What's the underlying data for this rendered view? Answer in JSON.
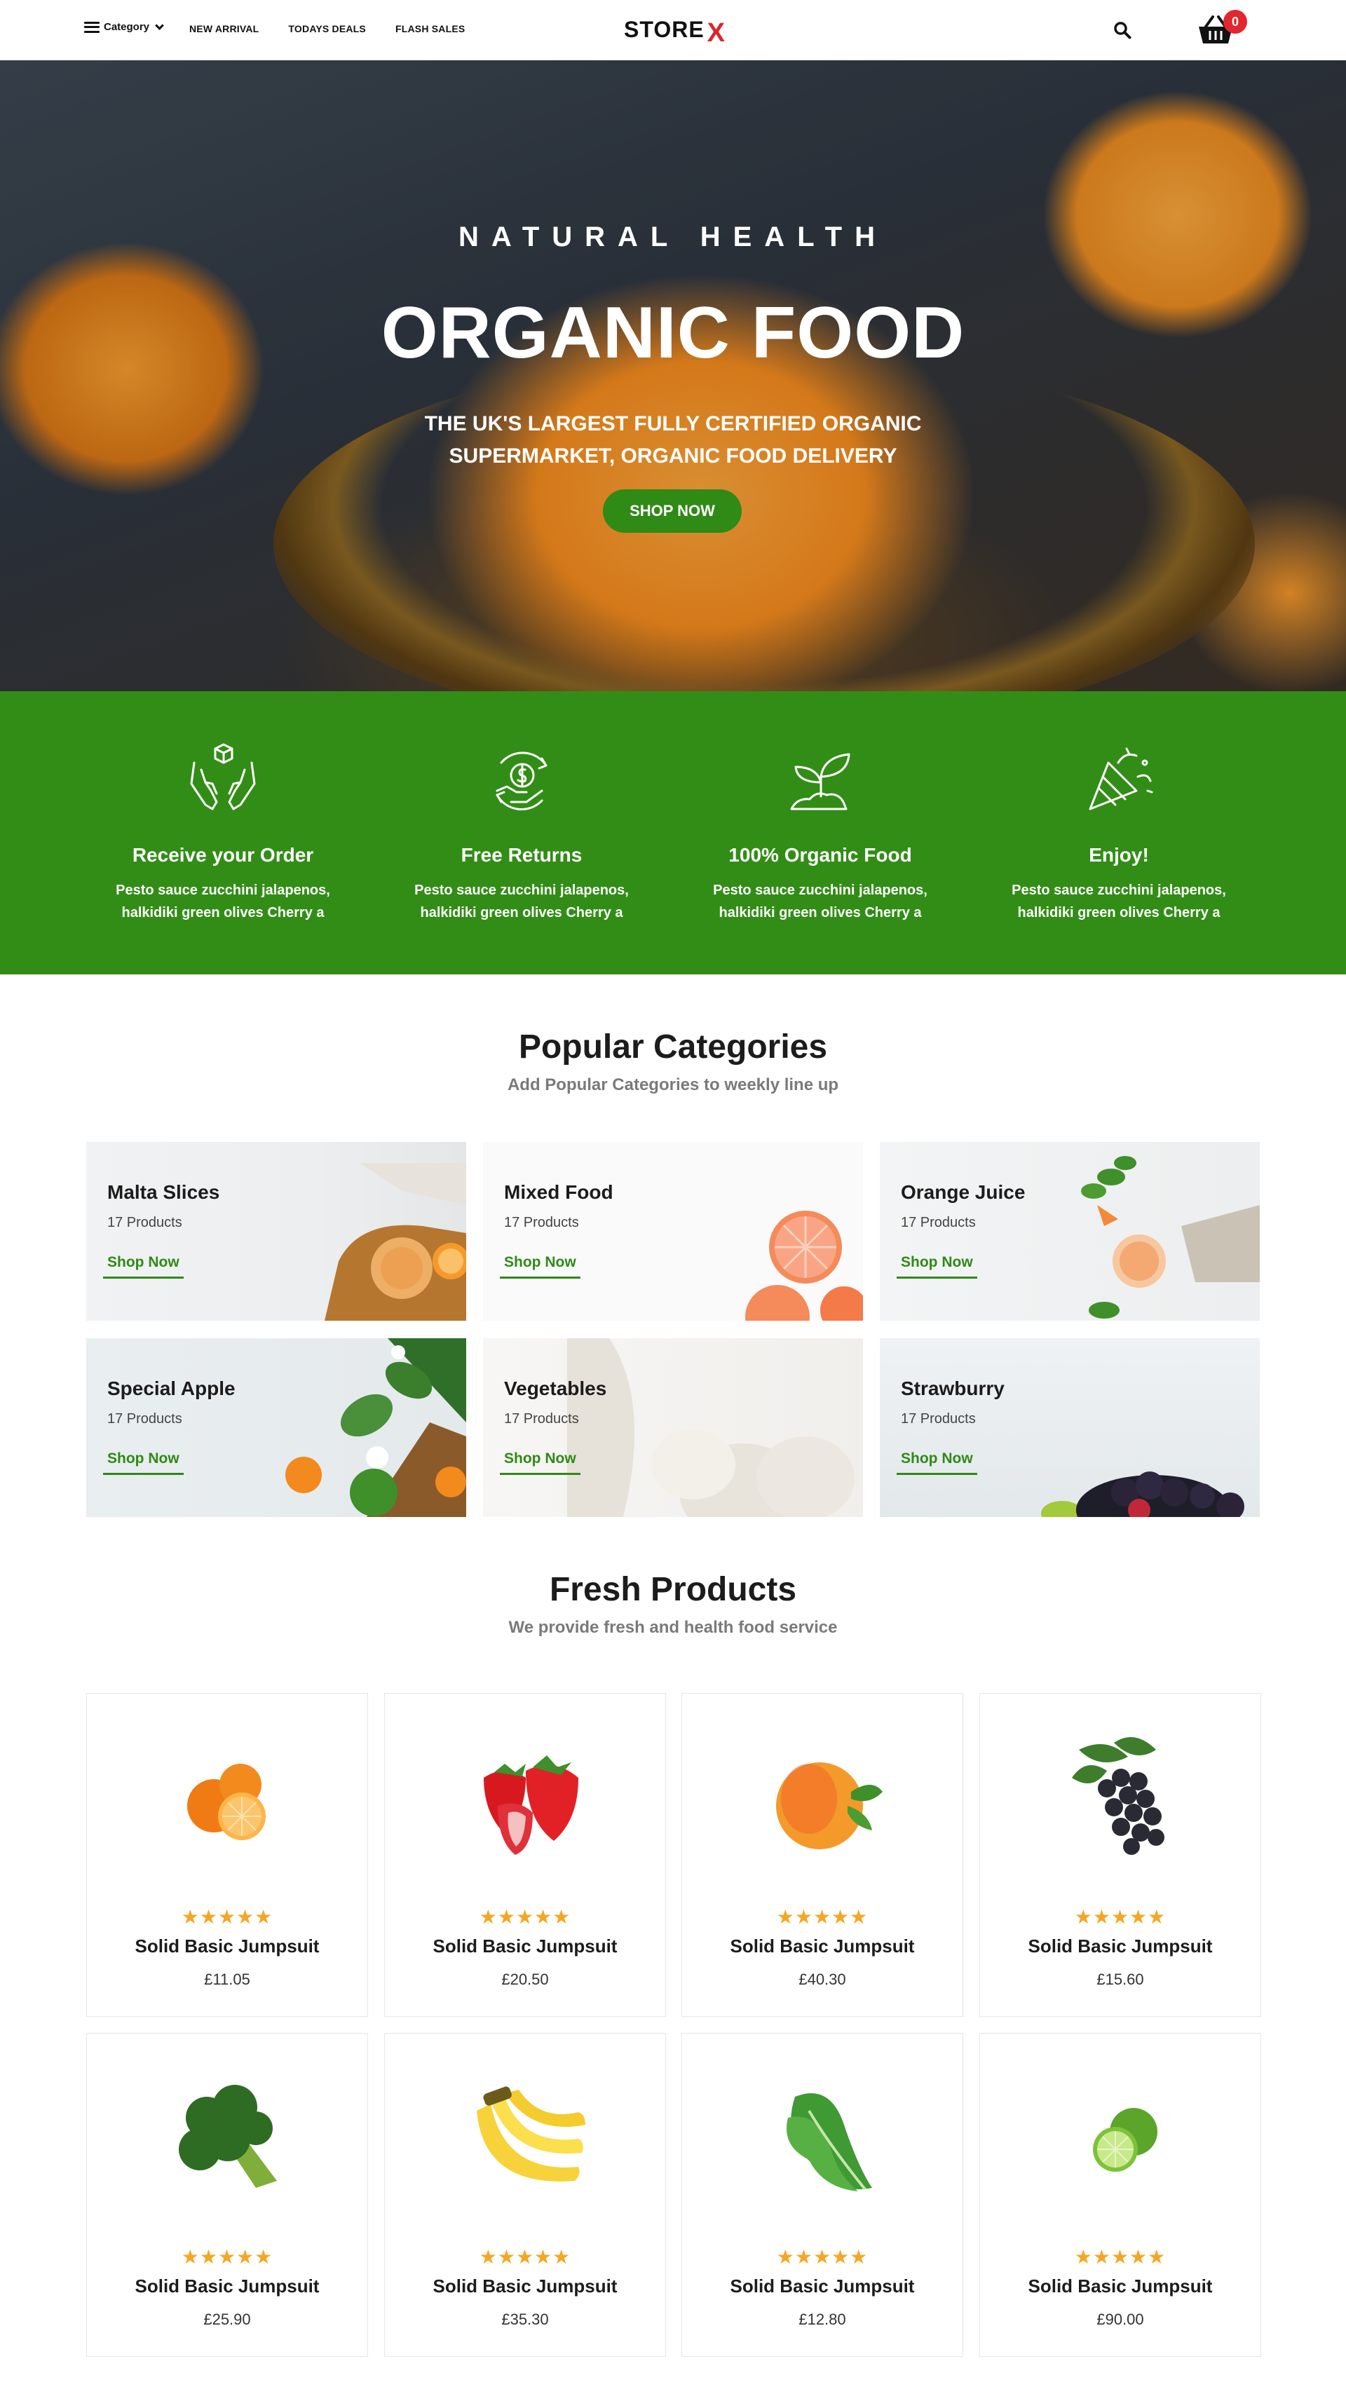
{
  "header": {
    "menu_label": "Category",
    "nav": [
      "NEW ARRIVAL",
      "TODAYS DEALS",
      "FLASH SALES"
    ],
    "logo_text": "STORE",
    "logo_mark": "X",
    "cart_count": "0",
    "icons": [
      "hamburger-icon",
      "chevron-down-icon",
      "search-icon",
      "basket-icon"
    ]
  },
  "hero": {
    "kicker": "NATURAL HEALTH",
    "title": "ORGANIC FOOD",
    "subtitle": "THE UK'S LARGEST FULLY CERTIFIED ORGANIC SUPERMARKET, ORGANIC FOOD DELIVERY",
    "button": "SHOP NOW"
  },
  "features": [
    {
      "title": "Receive your Order",
      "desc": "Pesto sauce zucchini jalapenos, halkidiki green olives Cherry a",
      "icon": "hands-box-icon"
    },
    {
      "title": "Free Returns",
      "desc": "Pesto sauce zucchini jalapenos, halkidiki green olives Cherry a",
      "icon": "money-return-icon"
    },
    {
      "title": "100% Organic Food",
      "desc": "Pesto sauce zucchini jalapenos, halkidiki green olives Cherry a",
      "icon": "sprout-icon"
    },
    {
      "title": "Enjoy!",
      "desc": "Pesto sauce zucchini jalapenos, halkidiki green olives Cherry a",
      "icon": "party-popper-icon"
    }
  ],
  "categories_section": {
    "title": "Popular Categories",
    "subtitle": "Add Popular Categories to weekly line up",
    "items": [
      {
        "name": "Malta Slices",
        "count": "17 Products",
        "cta": "Shop Now"
      },
      {
        "name": "Mixed Food",
        "count": "17 Products",
        "cta": "Shop Now"
      },
      {
        "name": "Orange Juice",
        "count": "17 Products",
        "cta": "Shop Now"
      },
      {
        "name": "Special Apple",
        "count": "17 Products",
        "cta": "Shop Now"
      },
      {
        "name": "Vegetables",
        "count": "17 Products",
        "cta": "Shop Now"
      },
      {
        "name": "Strawburry",
        "count": "17 Products",
        "cta": "Shop Now"
      }
    ]
  },
  "products_section": {
    "title": "Fresh Products",
    "subtitle": "We provide fresh and health food service",
    "items": [
      {
        "name": "Solid Basic Jumpsuit",
        "price": "£11.05",
        "rating": 5,
        "image": "orange"
      },
      {
        "name": "Solid Basic Jumpsuit",
        "price": "£20.50",
        "rating": 5,
        "image": "strawberry"
      },
      {
        "name": "Solid Basic Jumpsuit",
        "price": "£40.30",
        "rating": 5,
        "image": "peach"
      },
      {
        "name": "Solid Basic Jumpsuit",
        "price": "£15.60",
        "rating": 5,
        "image": "grapes"
      },
      {
        "name": "Solid Basic Jumpsuit",
        "price": "£25.90",
        "rating": 5,
        "image": "broccoli"
      },
      {
        "name": "Solid Basic Jumpsuit",
        "price": "£35.30",
        "rating": 5,
        "image": "banana"
      },
      {
        "name": "Solid Basic Jumpsuit",
        "price": "£12.80",
        "rating": 5,
        "image": "lettuce"
      },
      {
        "name": "Solid Basic Jumpsuit",
        "price": "£90.00",
        "rating": 5,
        "image": "lime"
      }
    ]
  },
  "colors": {
    "brand_green": "#328d16",
    "accent_red": "#e0282e",
    "star": "#f5a623"
  }
}
